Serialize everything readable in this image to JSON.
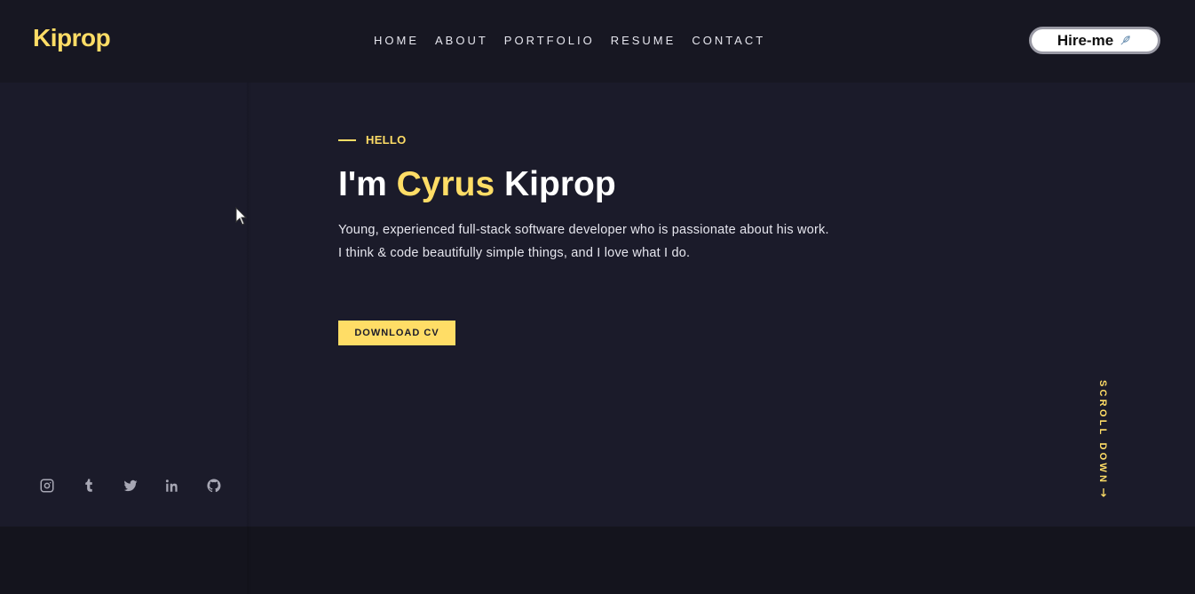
{
  "header": {
    "logo": "Kiprop",
    "nav": [
      "HOME",
      "ABOUT",
      "PORTFOLIO",
      "RESUME",
      "CONTACT"
    ],
    "hire_button": "Hire-me"
  },
  "hero": {
    "eyebrow": "HELLO",
    "headline_prefix": "I'm ",
    "headline_accent": "Cyrus",
    "headline_suffix": " Kiprop",
    "description_line1": "Young, experienced full-stack software developer who is passionate about his work.",
    "description_line2": "I think & code beautifully simple things, and I love what I do.",
    "download_button": "DOWNLOAD CV",
    "scroll_label": "SCROLL DOWN",
    "scroll_arrow": "→"
  },
  "socials": [
    {
      "icon": "instagram-icon"
    },
    {
      "icon": "tumblr-icon"
    },
    {
      "icon": "twitter-icon"
    },
    {
      "icon": "linkedin-icon"
    },
    {
      "icon": "github-icon"
    }
  ],
  "colors": {
    "accent": "#ffdd66",
    "background": "#1b1b2a",
    "header": "#171722",
    "text": "#e6e6ee"
  }
}
